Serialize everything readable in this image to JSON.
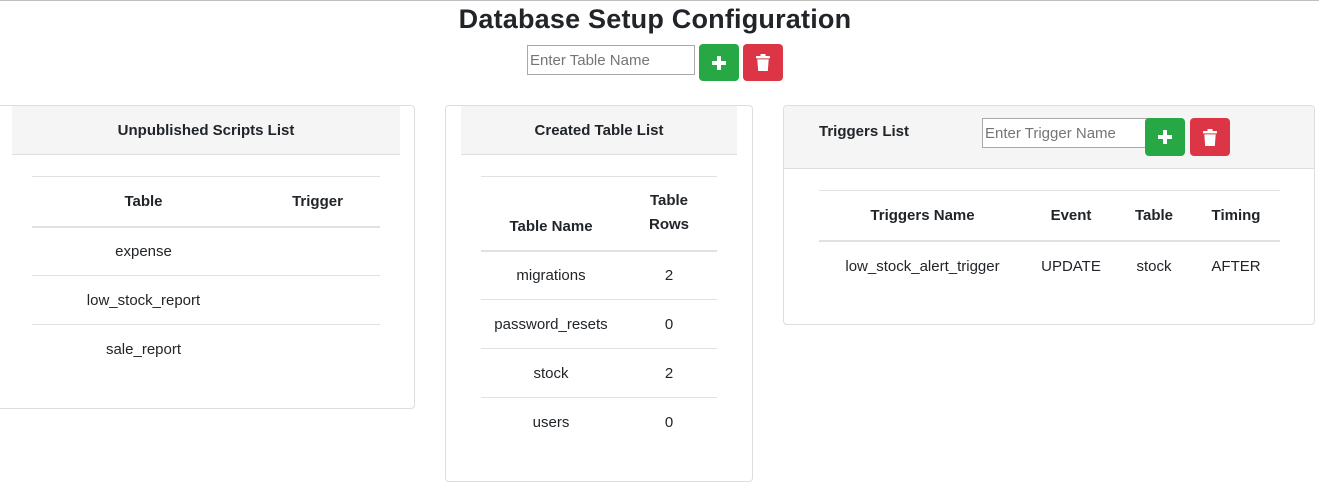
{
  "page": {
    "title": "Database Setup Configuration"
  },
  "table_form": {
    "placeholder": "Enter Table Name",
    "add_icon": "plus-icon",
    "delete_icon": "trash-icon"
  },
  "colors": {
    "green": "#28a745",
    "red": "#dc3545",
    "header_bg": "#f5f5f5"
  },
  "unpublished": {
    "title": "Unpublished Scripts List",
    "columns": [
      "Table",
      "Trigger"
    ],
    "rows": [
      {
        "table": "expense",
        "trigger": ""
      },
      {
        "table": "low_stock_report",
        "trigger": ""
      },
      {
        "table": "sale_report",
        "trigger": ""
      }
    ]
  },
  "created": {
    "title": "Created Table List",
    "columns": [
      "Table Name",
      "Table Rows"
    ],
    "rows": [
      {
        "name": "migrations",
        "rows": "2"
      },
      {
        "name": "password_resets",
        "rows": "0"
      },
      {
        "name": "stock",
        "rows": "2"
      },
      {
        "name": "users",
        "rows": "0"
      }
    ]
  },
  "triggers": {
    "title": "Triggers List",
    "placeholder": "Enter Trigger Name",
    "columns": [
      "Triggers Name",
      "Event",
      "Table",
      "Timing"
    ],
    "rows": [
      {
        "name": "low_stock_alert_trigger",
        "event": "UPDATE",
        "table": "stock",
        "timing": "AFTER"
      }
    ]
  }
}
